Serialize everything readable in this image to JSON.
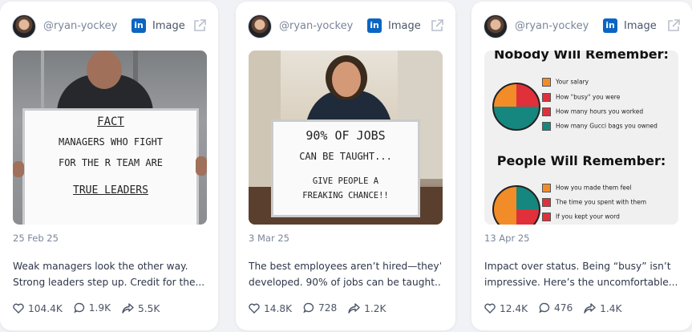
{
  "cards": [
    {
      "handle": "@ryan-yockey",
      "type_label": "Image",
      "date": "25 Feb 25",
      "caption_line1": "Weak managers look the other way.",
      "caption_line2": "Strong leaders step up. Credit for the...",
      "likes": "104.4K",
      "comments": "1.9K",
      "shares": "5.5K",
      "sign": {
        "line1": "FACT",
        "line2": "MANAGERS WHO FIGHT",
        "line3": "FOR THE R TEAM ARE",
        "line4": "TRUE LEADERS"
      }
    },
    {
      "handle": "@ryan-yockey",
      "type_label": "Image",
      "date": "3 Mar 25",
      "caption_line1": "The best employees aren’t hired—they’re",
      "caption_line2": "developed. 90% of jobs can be taught....",
      "likes": "14.8K",
      "comments": "728",
      "shares": "1.2K",
      "sign": {
        "line1": "90% OF JOBS",
        "line2": "CAN BE TAUGHT...",
        "line3": "GIVE PEOPLE A",
        "line4": "FREAKING CHANCE!!"
      }
    },
    {
      "handle": "@ryan-yockey",
      "type_label": "Image",
      "date": "13 Apr 25",
      "caption_line1": "Impact over status. Being “busy” isn’t",
      "caption_line2": "impressive. Here’s the uncomfortable...",
      "likes": "12.4K",
      "comments": "476",
      "shares": "1.4K",
      "infographic": {
        "heading1": "Nobody Will Remember:",
        "list1": [
          "Your salary",
          "How \"busy\" you were",
          "How many hours you worked",
          "How many Gucci bags you owned"
        ],
        "heading2": "People Will Remember:",
        "list2": [
          "How you made them feel",
          "The time you spent with them",
          "If you kept your word"
        ]
      }
    }
  ],
  "colors": {
    "linkedin": "#0a66c2",
    "pie_orange": "#f28c28",
    "pie_red": "#e0303a",
    "pie_teal": "#16877f"
  }
}
